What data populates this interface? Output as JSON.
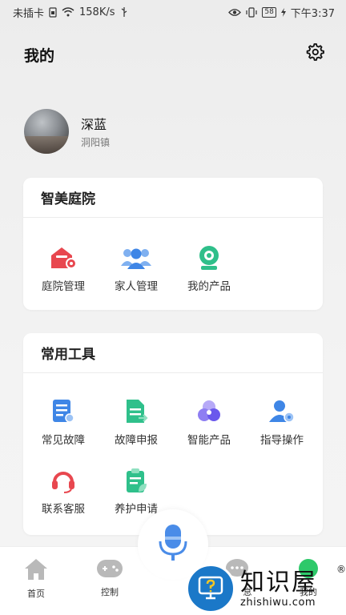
{
  "status_bar": {
    "carrier": "未插卡",
    "speed": "158K/s",
    "battery": "58",
    "time": "下午3:37"
  },
  "header": {
    "title": "我的",
    "settings_icon": "gear-icon"
  },
  "profile": {
    "name": "深蓝",
    "location": "洞阳镇"
  },
  "card_courtyard": {
    "title": "智美庭院",
    "items": [
      {
        "label": "庭院管理",
        "icon": "house-gear-icon",
        "color": "#e8474f"
      },
      {
        "label": "家人管理",
        "icon": "people-group-icon",
        "color": "#4a8ce8"
      },
      {
        "label": "我的产品",
        "icon": "camera-product-icon",
        "color": "#2fbf8a"
      }
    ]
  },
  "card_tools": {
    "title": "常用工具",
    "items": [
      {
        "label": "常见故障",
        "icon": "doc-search-icon",
        "color": "#3f86e6"
      },
      {
        "label": "故障申报",
        "icon": "doc-report-icon",
        "color": "#2fc08b"
      },
      {
        "label": "智能产品",
        "icon": "smart-product-icon",
        "color": "#7b6cf0"
      },
      {
        "label": "指导操作",
        "icon": "user-gear-icon",
        "color": "#3f86e6"
      },
      {
        "label": "联系客服",
        "icon": "headset-icon",
        "color": "#e8474f"
      },
      {
        "label": "养护申请",
        "icon": "clipboard-leaf-icon",
        "color": "#2fc08b"
      }
    ]
  },
  "bottom_nav": {
    "items": [
      {
        "label": "首页",
        "icon": "home-icon"
      },
      {
        "label": "控制",
        "icon": "gamepad-icon"
      },
      {
        "label": "息",
        "icon": "message-icon"
      },
      {
        "label": "我的",
        "icon": "profile-icon"
      }
    ],
    "mic_icon": "microphone-icon"
  },
  "watermark": {
    "cn": "知识屋",
    "en": "zhishiwu.com",
    "reg": "®"
  }
}
